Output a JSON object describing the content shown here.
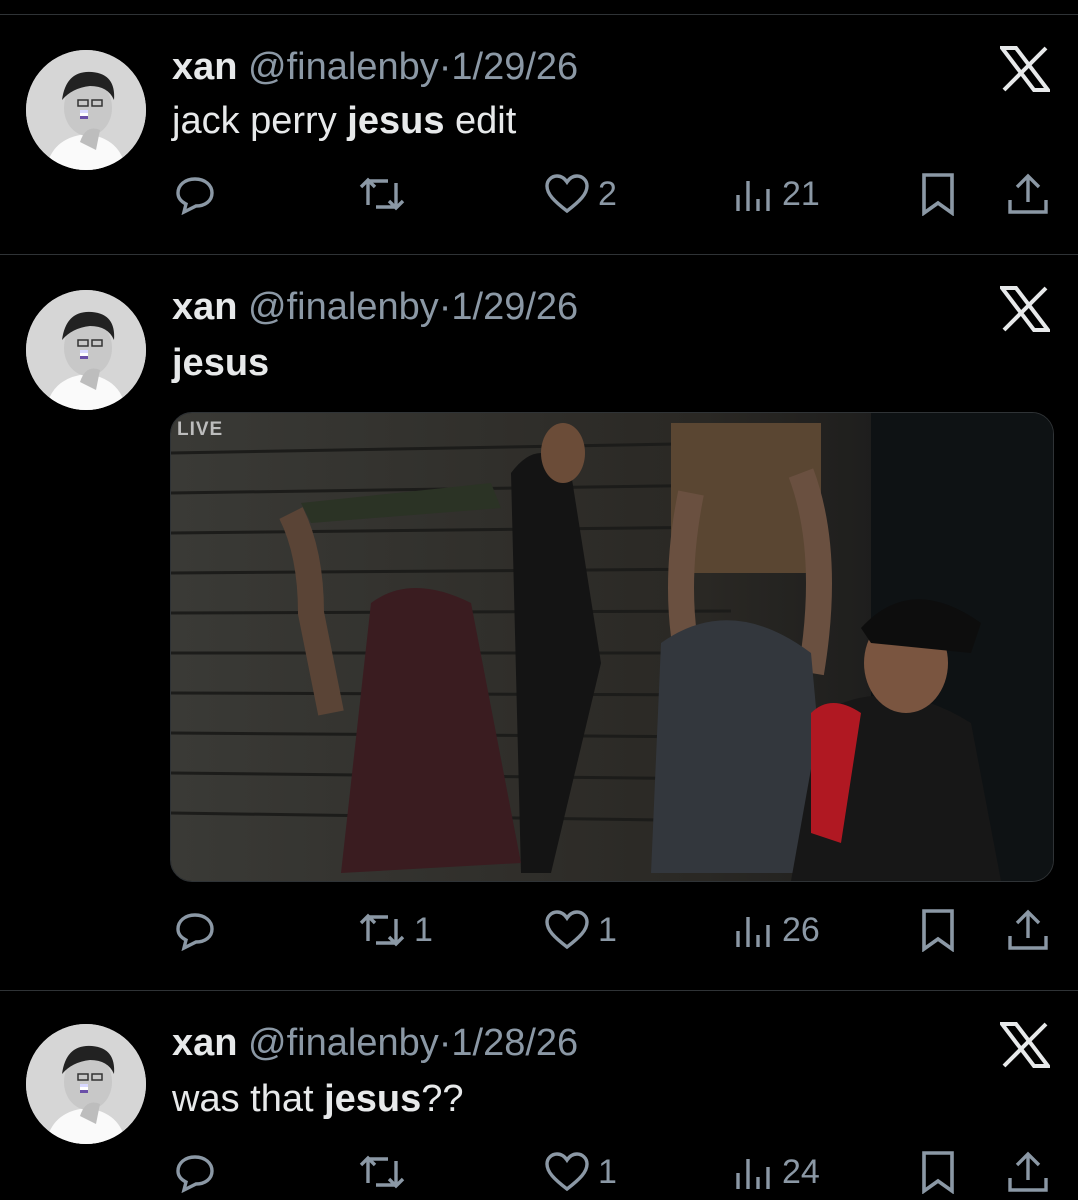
{
  "colors": {
    "background": "#000000",
    "text": "#e7e9ea",
    "muted": "#8b98a5",
    "divider": "#2f3336"
  },
  "tweets": [
    {
      "name": "xan",
      "handle": "@finalenby",
      "separator": "·",
      "date": "1/29/26",
      "text_parts": [
        "jack perry ",
        "jesus",
        " edit"
      ],
      "reply_icon": "reply-icon",
      "retweet_icon": "retweet-icon",
      "retweets": "",
      "like_icon": "heart-icon",
      "likes": "2",
      "views_icon": "views-icon",
      "views": "21",
      "bookmark_icon": "bookmark-icon",
      "share_icon": "share-icon"
    },
    {
      "name": "xan",
      "handle": "@finalenby",
      "separator": "·",
      "date": "1/29/26",
      "text_parts": [
        "jesus"
      ],
      "media_badge": "LIVE",
      "retweets": "1",
      "likes": "1",
      "views": "26"
    },
    {
      "name": "xan",
      "handle": "@finalenby",
      "separator": "·",
      "date": "1/28/26",
      "text_parts": [
        "was that ",
        "jesus",
        "??"
      ],
      "retweets": "",
      "likes": "1",
      "views": "24"
    }
  ]
}
